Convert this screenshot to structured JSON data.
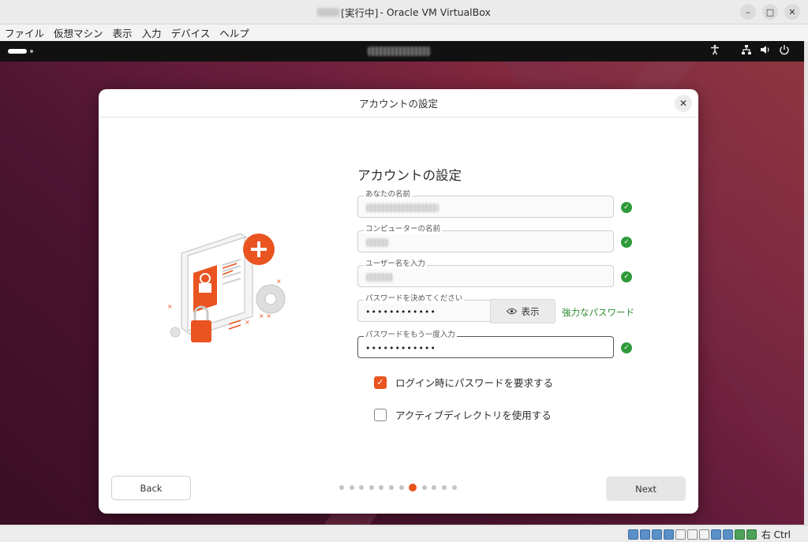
{
  "host": {
    "title_state": "[実行中]",
    "title_app": " - Oracle VM VirtualBox",
    "menu": [
      "ファイル",
      "仮想マシン",
      "表示",
      "入力",
      "デバイス",
      "ヘルプ"
    ],
    "host_key": "右 Ctrl"
  },
  "dialog": {
    "header": "アカウントの設定",
    "heading": "アカウントの設定",
    "fields": {
      "name_label": "あなたの名前",
      "computer_label": "コンピューターの名前",
      "username_label": "ユーザー名を入力",
      "password_label": "パスワードを決めてください",
      "password_value": "••••••••••••",
      "confirm_label": "パスワードをもう一度入力",
      "confirm_value": "••••••••••••"
    },
    "show_button": "表示",
    "password_strength": "強力なパスワード",
    "options": {
      "require_password_label": "ログイン時にパスワードを要求する",
      "require_password_checked": true,
      "active_directory_label": "アクティブディレクトリを使用する",
      "active_directory_checked": false
    },
    "back_label": "Back",
    "next_label": "Next",
    "pager": {
      "total": 12,
      "current": 8
    }
  },
  "colors": {
    "accent": "#e95420",
    "ok": "#2e9a3a"
  },
  "icons": [
    "accessibility-icon",
    "network-icon",
    "volume-icon",
    "power-icon",
    "close-icon",
    "eye-icon",
    "check-icon"
  ]
}
